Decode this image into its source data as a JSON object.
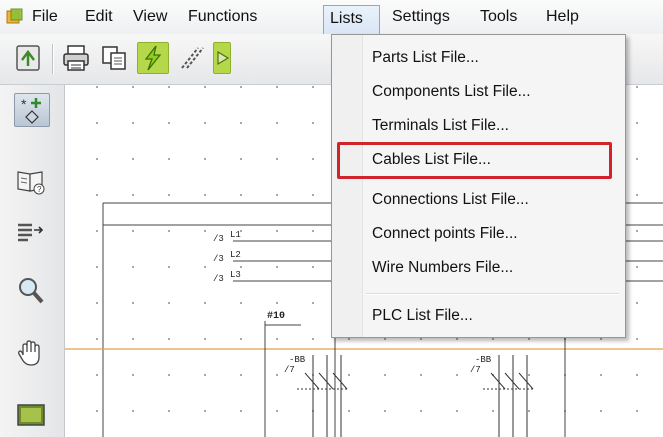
{
  "menubar": {
    "items": [
      "File",
      "Edit",
      "View",
      "Functions",
      "Lists",
      "Settings",
      "Tools",
      "Help"
    ],
    "open_menu": "Lists"
  },
  "lists_menu": {
    "items": [
      "Parts List File...",
      "Components List File...",
      "Terminals List File...",
      "Cables List File...",
      "Connections List File...",
      "Connect points File...",
      "Wire Numbers File...",
      "PLC List File..."
    ],
    "highlighted": "Cables List File..."
  },
  "schematic": {
    "wire_labels": [
      "L1",
      "L2",
      "L3"
    ],
    "ref_labels": [
      "/3",
      "/3",
      "/3"
    ],
    "net_label": "#10",
    "component_labels": [
      "-BB",
      "/7",
      "-BB",
      "/7"
    ]
  },
  "colors": {
    "highlight_border": "#d1232a",
    "toolbar_green": "#b5d84a",
    "schematic_orange": "#e8a04a",
    "menu_open_bg": "#dbe7f6"
  }
}
